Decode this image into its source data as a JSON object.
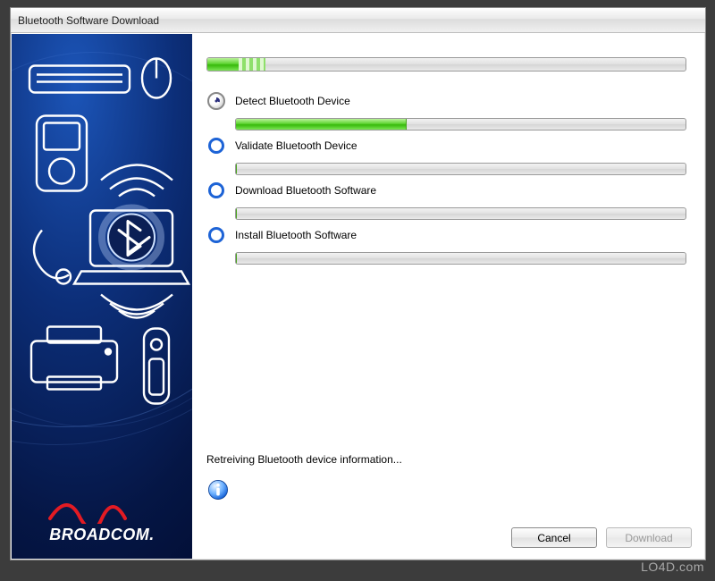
{
  "window": {
    "title": "Bluetooth Software Download"
  },
  "sidebar": {
    "brand": "BROADCOM."
  },
  "overall_progress": {
    "percent": 9
  },
  "steps": [
    {
      "label": "Detect Bluetooth Device",
      "state": "active",
      "progress": 38
    },
    {
      "label": "Validate Bluetooth Device",
      "state": "pending",
      "progress": 0
    },
    {
      "label": "Download Bluetooth Software",
      "state": "pending",
      "progress": 0
    },
    {
      "label": "Install Bluetooth Software",
      "state": "pending",
      "progress": 0
    }
  ],
  "status": {
    "message": "Retreiving Bluetooth device information..."
  },
  "buttons": {
    "cancel": "Cancel",
    "download": "Download"
  },
  "watermark": "LO4D.com"
}
